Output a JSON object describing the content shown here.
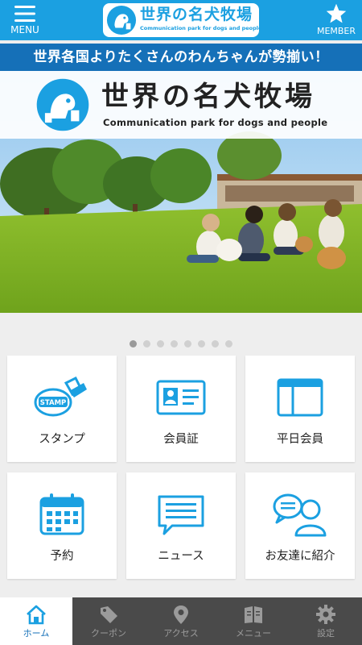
{
  "header": {
    "menu_label": "MENU",
    "member_label": "MEMBER",
    "logo_title": "世界の名犬牧場",
    "logo_subtitle": "Communication park for dogs and people"
  },
  "tagline": "世界各国よりたくさんのわんちゃんが勢揃い！",
  "banner": {
    "title": "世界の名犬牧場",
    "subtitle": "Communication park for dogs and people",
    "slide_count": 8,
    "active_slide": 1
  },
  "tiles": [
    {
      "label": "スタンプ",
      "icon": "stamp-icon",
      "stamp_text": "STAMP"
    },
    {
      "label": "会員証",
      "icon": "member-card-icon"
    },
    {
      "label": "平日会員",
      "icon": "weekday-member-icon"
    },
    {
      "label": "予約",
      "icon": "calendar-icon"
    },
    {
      "label": "ニュース",
      "icon": "news-icon"
    },
    {
      "label": "お友達に紹介",
      "icon": "refer-friend-icon"
    }
  ],
  "bottom_nav": [
    {
      "label": "ホーム",
      "icon": "home-icon",
      "active": true
    },
    {
      "label": "クーポン",
      "icon": "coupon-icon",
      "active": false
    },
    {
      "label": "アクセス",
      "icon": "map-pin-icon",
      "active": false
    },
    {
      "label": "メニュー",
      "icon": "book-icon",
      "active": false
    },
    {
      "label": "設定",
      "icon": "gear-icon",
      "active": false
    }
  ],
  "colors": {
    "header_blue": "#1ba0e1",
    "tagline_blue": "#1570b8",
    "icon_blue": "#1ba0e1",
    "nav_bg": "#4a4a4a"
  }
}
